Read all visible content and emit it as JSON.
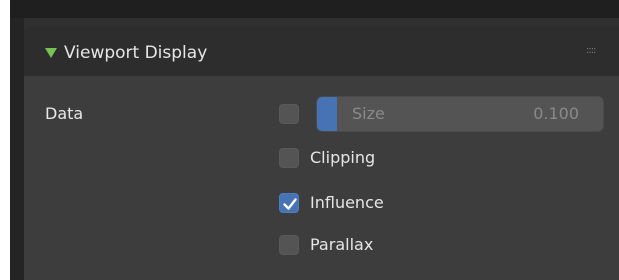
{
  "panel": {
    "title": "Viewport Display",
    "header_icon": "triangle-down-icon",
    "drag_icon": "drag-handle-icon",
    "accent_green": "#78c157",
    "accent_blue": "#4772b3"
  },
  "data_row": {
    "label": "Data",
    "checkbox_checked": false,
    "size_field": {
      "label": "Size",
      "value": "0.100",
      "fill_fraction": 0.07
    }
  },
  "options": [
    {
      "label": "Clipping",
      "checked": false
    },
    {
      "label": "Influence",
      "checked": true
    },
    {
      "label": "Parallax",
      "checked": false
    }
  ]
}
